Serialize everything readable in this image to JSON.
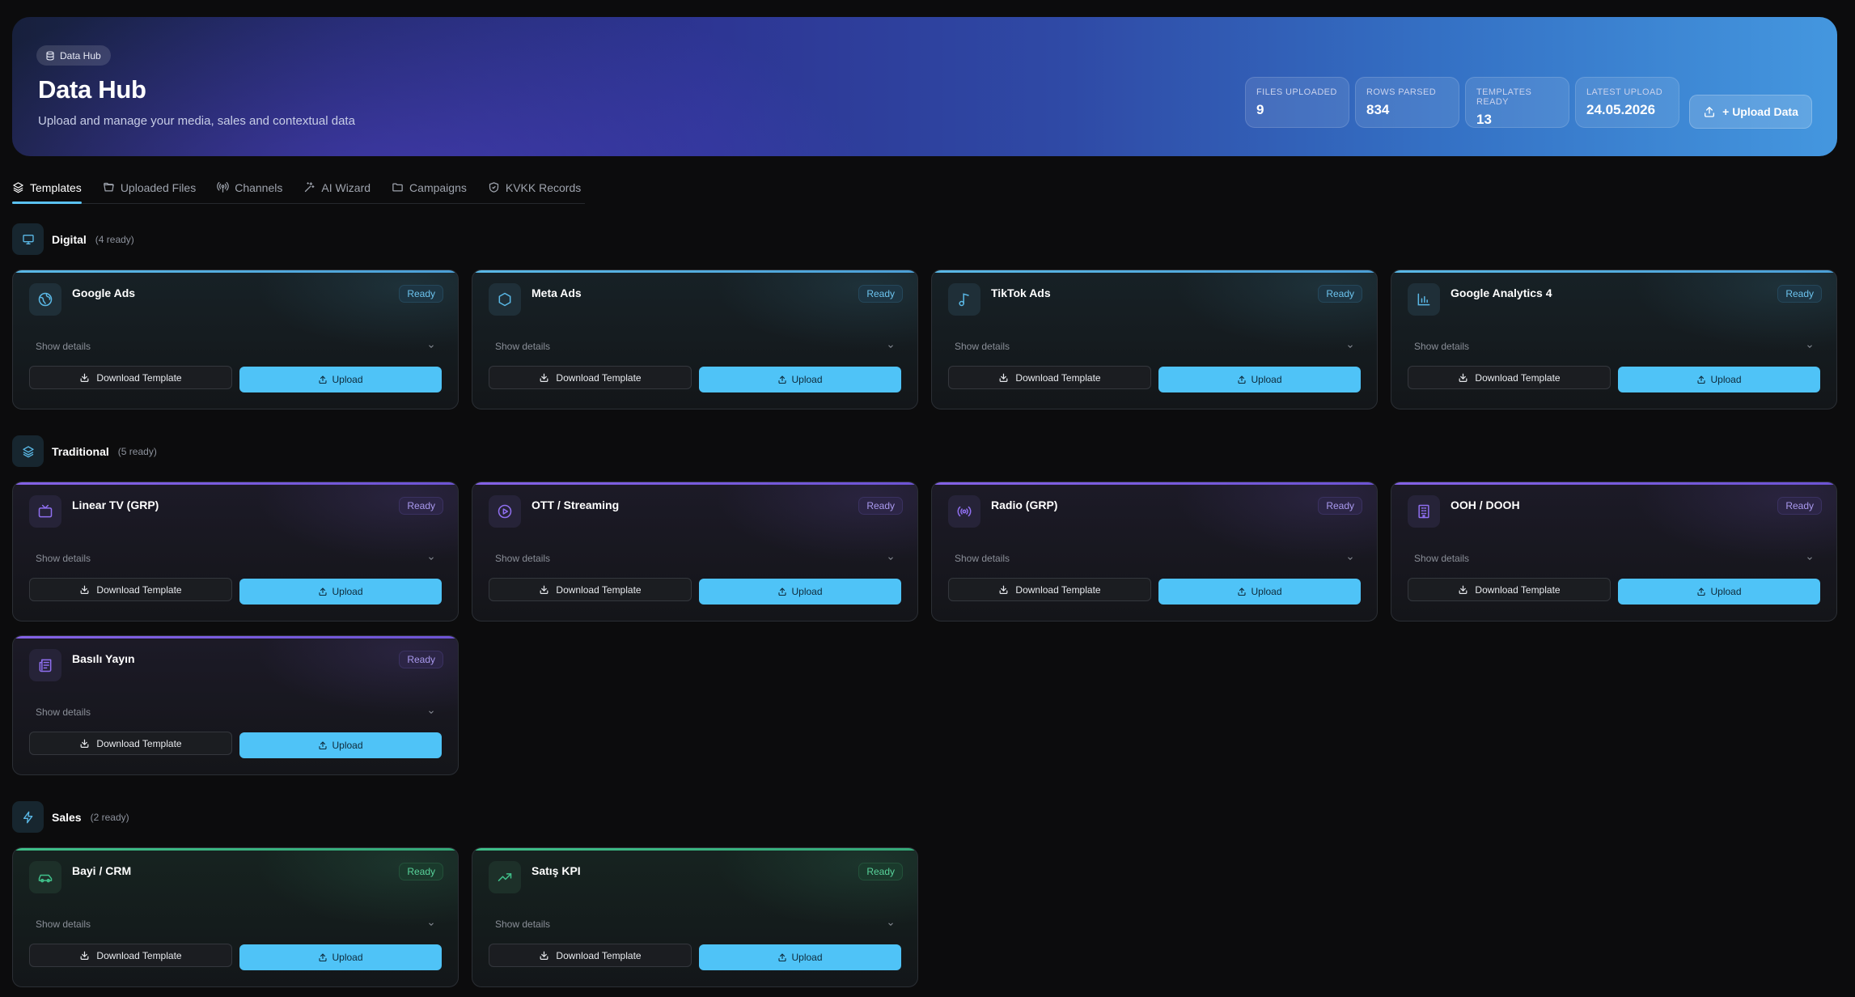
{
  "hero": {
    "tag": "Data Hub",
    "title": "Data Hub",
    "subtitle": "Upload and manage your media, sales and contextual data",
    "stats": [
      {
        "label": "FILES UPLOADED",
        "value": "9"
      },
      {
        "label": "ROWS PARSED",
        "value": "834"
      },
      {
        "label": "TEMPLATES READY",
        "value": "13"
      },
      {
        "label": "LATEST UPLOAD",
        "value": "24.05.2026"
      }
    ],
    "upload_button": "+ Upload Data"
  },
  "tabs": [
    {
      "label": "Templates",
      "icon": "layers-icon",
      "active": true
    },
    {
      "label": "Uploaded Files",
      "icon": "folder-open-icon"
    },
    {
      "label": "Channels",
      "icon": "broadcast-icon"
    },
    {
      "label": "AI Wizard",
      "icon": "sparkles-icon"
    },
    {
      "label": "Campaigns",
      "icon": "folder-icon"
    },
    {
      "label": "KVKK Records",
      "icon": "shield-check-icon"
    }
  ],
  "colors": {
    "accent": "#4fc3f7",
    "digital": "#5ab8e6",
    "traditional": "#8462e6",
    "sales": "#3fbf89"
  },
  "common": {
    "show_details": "Show details",
    "download": "Download Template",
    "upload": "Upload"
  },
  "sections": {
    "digital": {
      "title": "Digital",
      "count": "(4 ready)",
      "icon": "monitor-icon",
      "cards": [
        {
          "title": "Google Ads",
          "badge": "Ready",
          "icon": "globe-icon"
        },
        {
          "title": "Meta Ads",
          "badge": "Ready",
          "icon": "hexagon-icon"
        },
        {
          "title": "TikTok Ads",
          "badge": "Ready",
          "icon": "music-note-icon"
        },
        {
          "title": "Google Analytics 4",
          "badge": "Ready",
          "icon": "bar-chart-icon"
        }
      ]
    },
    "traditional": {
      "title": "Traditional",
      "count": "(5 ready)",
      "icon": "layers-icon",
      "cards": [
        {
          "title": "Linear TV (GRP)",
          "badge": "Ready",
          "icon": "tv-icon"
        },
        {
          "title": "OTT / Streaming",
          "badge": "Ready",
          "icon": "play-circle-icon"
        },
        {
          "title": "Radio (GRP)",
          "badge": "Ready",
          "icon": "radio-icon"
        },
        {
          "title": "OOH / DOOH",
          "badge": "Ready",
          "icon": "building-icon"
        },
        {
          "title": "Basılı Yayın",
          "badge": "Ready",
          "icon": "newspaper-icon"
        }
      ]
    },
    "sales": {
      "title": "Sales",
      "count": "(2 ready)",
      "icon": "bolt-icon",
      "cards": [
        {
          "title": "Bayi / CRM",
          "badge": "Ready",
          "icon": "car-icon"
        },
        {
          "title": "Satış KPI",
          "badge": "Ready",
          "icon": "trend-up-icon"
        }
      ]
    }
  }
}
